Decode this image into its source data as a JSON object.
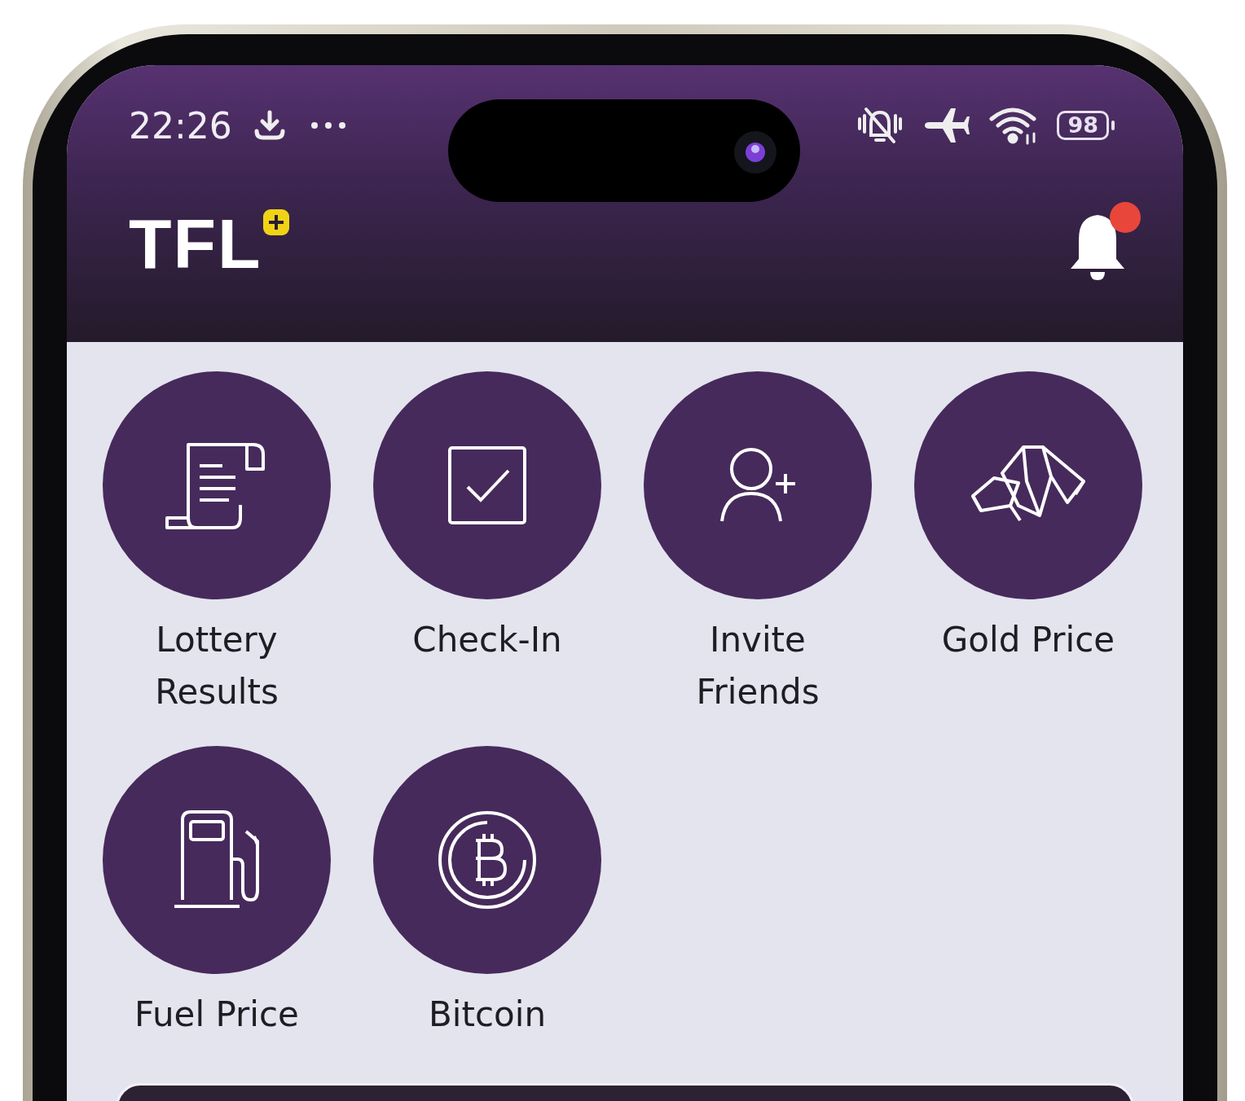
{
  "status_bar": {
    "time": "22:26",
    "battery": "98"
  },
  "header": {
    "logo": "TFL"
  },
  "tiles": [
    {
      "label": "Lottery Results"
    },
    {
      "label": "Check-In"
    },
    {
      "label": "Invite Friends"
    },
    {
      "label": "Gold Price"
    },
    {
      "label": "Fuel Price"
    },
    {
      "label": "Bitcoin"
    }
  ]
}
